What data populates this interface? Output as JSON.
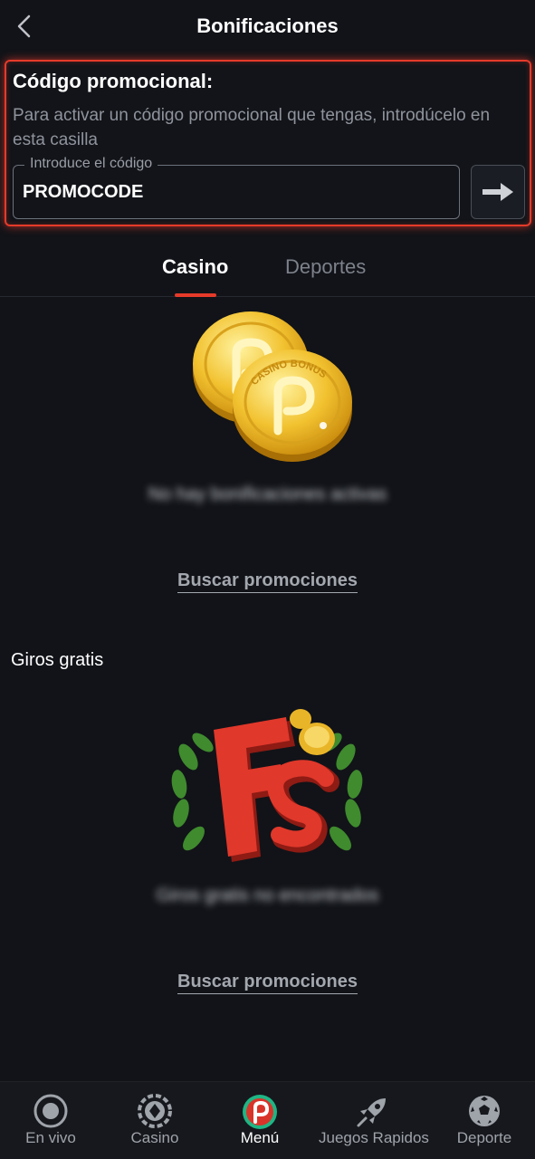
{
  "header": {
    "title": "Bonificaciones",
    "back_icon": "chevron-left-icon"
  },
  "promo": {
    "title": "Código promocional:",
    "description": "Para activar un código promocional que tengas, introdúcelo en esta casilla",
    "field_label": "Introduce el código",
    "field_value": "PROMOCODE",
    "submit_icon": "arrow-right-icon"
  },
  "tabs": [
    {
      "label": "Casino",
      "active": true
    },
    {
      "label": "Deportes",
      "active": false
    }
  ],
  "casino_section": {
    "empty_text": "No hay bonificaciones activas",
    "link": "Buscar promociones",
    "coin_text": "CASINO BONUS"
  },
  "free_spins_section": {
    "title": "Giros gratis",
    "empty_text": "Giros gratis no encontrados",
    "link": "Buscar promociones"
  },
  "bottom_nav": [
    {
      "label": "En vivo",
      "icon": "live-icon"
    },
    {
      "label": "Casino",
      "icon": "casino-chip-icon"
    },
    {
      "label": "Menú",
      "icon": "brand-logo-icon"
    },
    {
      "label": "Juegos Rapidos",
      "icon": "rocket-icon"
    },
    {
      "label": "Deporte",
      "icon": "soccer-ball-icon"
    }
  ],
  "colors": {
    "background": "#111318",
    "accent": "#e53a2a",
    "muted_text": "#8f939c",
    "nav_background": "#16181d",
    "brand_green": "#1fb584"
  }
}
